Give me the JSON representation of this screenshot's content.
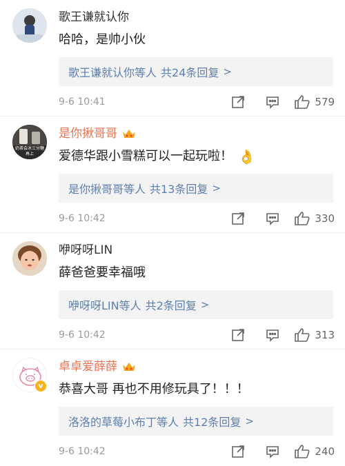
{
  "comments": [
    {
      "username": "歌王谦就认你",
      "text": "哈哈，是帅小伙",
      "reply_users": "歌王谦就认你等人",
      "reply_count": "共24条回复",
      "reply_arrow": ">",
      "time": "9-6 10:41",
      "likes": "579"
    },
    {
      "username": "是你揪哥哥",
      "text": "爱德华跟小雪糕可以一起玩啦！",
      "emoji": "👌",
      "reply_users": "是你揪哥哥等人",
      "reply_count": "共13条回复",
      "reply_arrow": ">",
      "time": "9-6 10:42",
      "likes": "330",
      "avatar_caption": "奶茶会冰三分糖 再上"
    },
    {
      "username": "咿呀呀LIN",
      "text": "薛爸爸要幸福哦",
      "reply_users": "咿呀呀LIN等人",
      "reply_count": "共2条回复",
      "reply_arrow": ">",
      "time": "9-6 10:42",
      "likes": "313"
    },
    {
      "username": "卓卓爱薛薛",
      "text": "恭喜大哥 再也不用修玩具了！！！",
      "reply_users": "洛洛的草莓小布丁等人",
      "reply_count": "共12条回复",
      "reply_arrow": ">",
      "time": "9-6 10:42",
      "likes": "240",
      "verified_badge": "v"
    }
  ],
  "colors": {
    "orange_name": "#eb7350",
    "link_blue": "#5c7fb0",
    "reply_bg": "#f3f3f3"
  },
  "icons": [
    "crown-badge-icon",
    "repost-icon",
    "comment-icon",
    "like-icon",
    "chevron-right-icon"
  ]
}
